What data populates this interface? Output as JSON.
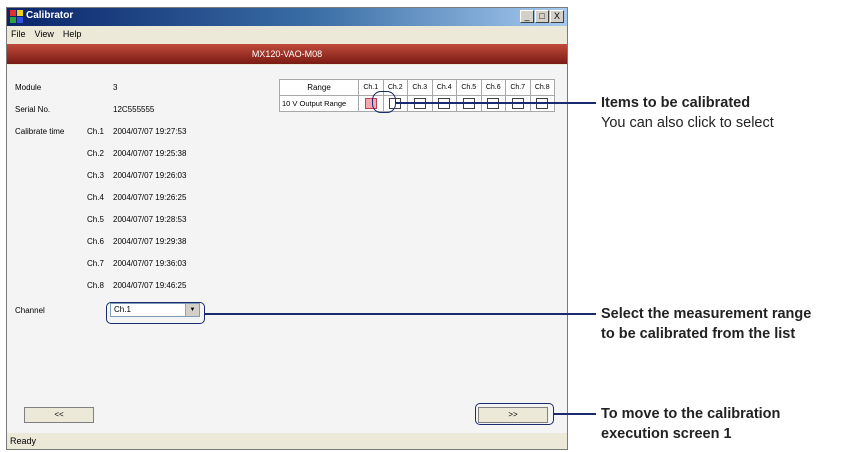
{
  "window": {
    "title": "Calibrator",
    "controls": [
      "_",
      "□",
      "X"
    ]
  },
  "menu": [
    "File",
    "View",
    "Help"
  ],
  "banner": "MX120-VAO-M08",
  "info": {
    "module_label": "Module",
    "module_value": "3",
    "serial_label": "Serial No.",
    "serial_value": "12C555555",
    "calibrate_label": "Calibrate time",
    "times": [
      {
        "ch": "Ch.1",
        "time": "2004/07/07 19:27:53"
      },
      {
        "ch": "Ch.2",
        "time": "2004/07/07 19:25:38"
      },
      {
        "ch": "Ch.3",
        "time": "2004/07/07 19:26:03"
      },
      {
        "ch": "Ch.4",
        "time": "2004/07/07 19:26:25"
      },
      {
        "ch": "Ch.5",
        "time": "2004/07/07 19:28:53"
      },
      {
        "ch": "Ch.6",
        "time": "2004/07/07 19:29:38"
      },
      {
        "ch": "Ch.7",
        "time": "2004/07/07 19:36:03"
      },
      {
        "ch": "Ch.8",
        "time": "2004/07/07 19:46:25"
      }
    ]
  },
  "range_table": {
    "header": "Range",
    "channels": [
      "Ch.1",
      "Ch.2",
      "Ch.3",
      "Ch.4",
      "Ch.5",
      "Ch.6",
      "Ch.7",
      "Ch.8"
    ],
    "row_label": "10 V Output Range",
    "selected": [
      true,
      false,
      false,
      false,
      false,
      false,
      false,
      false
    ]
  },
  "channel": {
    "label": "Channel",
    "value": "Ch.1"
  },
  "buttons": {
    "back": "<<",
    "next": ">>"
  },
  "status": "Ready",
  "annotations": {
    "items_title": "Items to be calibrated",
    "items_sub": "You can also click to select",
    "range_line1": "Select the measurement range",
    "range_line2": "to be calibrated from the list",
    "move_line1": "To move to the calibration",
    "move_line2": "execution screen 1"
  },
  "colors": {
    "banner": "#8b2a20",
    "selected_checkbox": "#f4a8b0",
    "callout": "#1a2a6e"
  }
}
